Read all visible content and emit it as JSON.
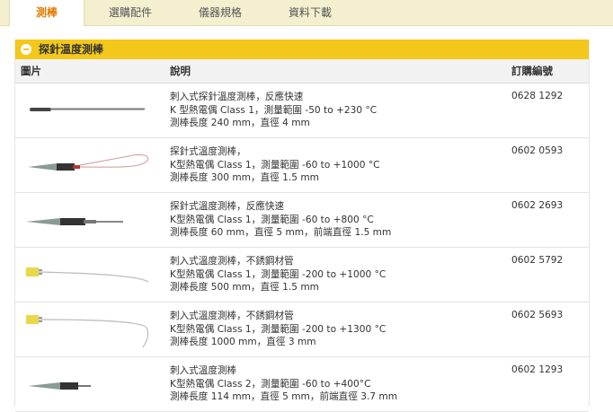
{
  "tabs": [
    {
      "label": "測棒",
      "active": true
    },
    {
      "label": "選購配件",
      "active": false
    },
    {
      "label": "儀器規格",
      "active": false
    },
    {
      "label": "資料下載",
      "active": false
    }
  ],
  "section": {
    "title": "探針溫度測棒"
  },
  "table": {
    "headers": {
      "picture": "圖片",
      "description": "說明",
      "order_no": "訂購編號"
    },
    "rows": [
      {
        "lines": [
          "刺入式探針溫度測棒，反應快速",
          "K 型熱電偶 Class 1，測量範圍 -50 to +230 °C",
          "測棒長度 240 mm，直徑 4 mm"
        ],
        "code": "0628 1292",
        "image": "probe-thin-handle-icon"
      },
      {
        "lines": [
          "探針式溫度測棒，",
          "K型熱電偶 Class 1，測量範圍 -60 to +1000 °C",
          "測棒長度 300 mm，直徑 1.5 mm"
        ],
        "code": "0602 0593",
        "image": "probe-handle-loop-icon"
      },
      {
        "lines": [
          "探針式溫度測棒，反應快速",
          "K型熱電偶 Class 1，測量範圍 -60 to +800 °C",
          "測棒長度 60 mm，直徑 5 mm，前端直徑 1.5 mm"
        ],
        "code": "0602 2693",
        "image": "probe-handle-short-tip-icon"
      },
      {
        "lines": [
          "刺入式溫度測棒，不銹鋼材管",
          "K型熱電偶 Class 1，測量範圍 -200 to +1000 °C",
          "測棒長度 500 mm，直徑 1.5 mm"
        ],
        "code": "0602 5792",
        "image": "probe-plug-wire-icon"
      },
      {
        "lines": [
          "刺入式溫度測棒，不銹鋼材管",
          "K型熱電偶 Class 1，測量範圍 -200 to +1300 °C",
          "測棒長度 1000 mm，直徑 3 mm"
        ],
        "code": "0602 5693",
        "image": "probe-plug-long-wire-icon"
      },
      {
        "lines": [
          "刺入式溫度測棒",
          "K型熱電偶 Class 2，測量範圍 -60 to +400°C",
          "測棒長度 114 mm，直徑 5 mm，前端直徑 3.7 mm"
        ],
        "code": "0602 1293",
        "image": "probe-handle-needle-icon"
      }
    ]
  },
  "colors": {
    "accent": "#f3c81b",
    "active_tab": "#e07b00",
    "tab_bar": "#f3efcf"
  }
}
